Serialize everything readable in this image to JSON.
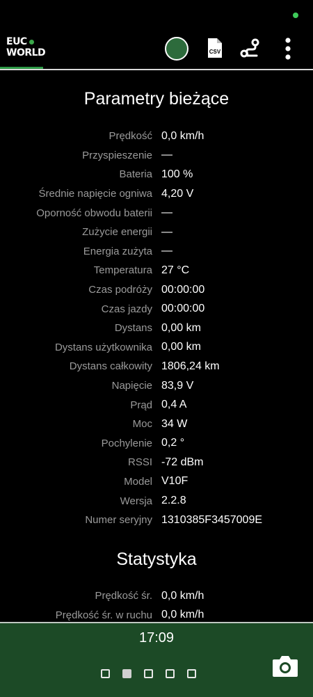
{
  "app": {
    "logo_line1": "EUC",
    "logo_line2": "WORLD"
  },
  "toolbar": {
    "csv_label": "CSV",
    "icons": [
      "connection-indicator",
      "csv-file-icon",
      "route-icon",
      "more-vert-icon"
    ]
  },
  "current": {
    "title": "Parametry bieżące",
    "rows": [
      {
        "label": "Prędkość",
        "value": "0,0 km/h"
      },
      {
        "label": "Przyspieszenie",
        "value": "—"
      },
      {
        "label": "Bateria",
        "value": "100 %"
      },
      {
        "label": "Średnie napięcie ogniwa",
        "value": "4,20 V"
      },
      {
        "label": "Oporność obwodu baterii",
        "value": "—"
      },
      {
        "label": "Zużycie energii",
        "value": "—"
      },
      {
        "label": "Energia zużyta",
        "value": "—"
      },
      {
        "label": "Temperatura",
        "value": "27 °C"
      },
      {
        "label": "Czas podróży",
        "value": "00:00:00"
      },
      {
        "label": "Czas jazdy",
        "value": "00:00:00"
      },
      {
        "label": "Dystans",
        "value": "0,00 km"
      },
      {
        "label": "Dystans użytkownika",
        "value": "0,00 km"
      },
      {
        "label": "Dystans całkowity",
        "value": "1806,24 km"
      },
      {
        "label": "Napięcie",
        "value": "83,9 V"
      },
      {
        "label": "Prąd",
        "value": "0,4 A"
      },
      {
        "label": "Moc",
        "value": "34 W"
      },
      {
        "label": "Pochylenie",
        "value": "0,2 °"
      },
      {
        "label": "RSSI",
        "value": "-72 dBm"
      },
      {
        "label": "Model",
        "value": "V10F"
      },
      {
        "label": "Wersja",
        "value": "2.2.8"
      },
      {
        "label": "Numer seryjny",
        "value": "1310385F3457009E"
      }
    ]
  },
  "stats": {
    "title": "Statystyka",
    "rows": [
      {
        "label": "Prędkość śr.",
        "value": "0,0 km/h"
      },
      {
        "label": "Prędkość śr. w ruchu",
        "value": "0,0 km/h"
      }
    ]
  },
  "bottom": {
    "clock": "17:09",
    "pages": 5,
    "active_page": 2
  },
  "colors": {
    "accent_green": "#2e9b47",
    "connection_fill": "#2d6b3c",
    "bottom_bar": "#1c4a26",
    "label_gray": "#9a9a9a"
  }
}
